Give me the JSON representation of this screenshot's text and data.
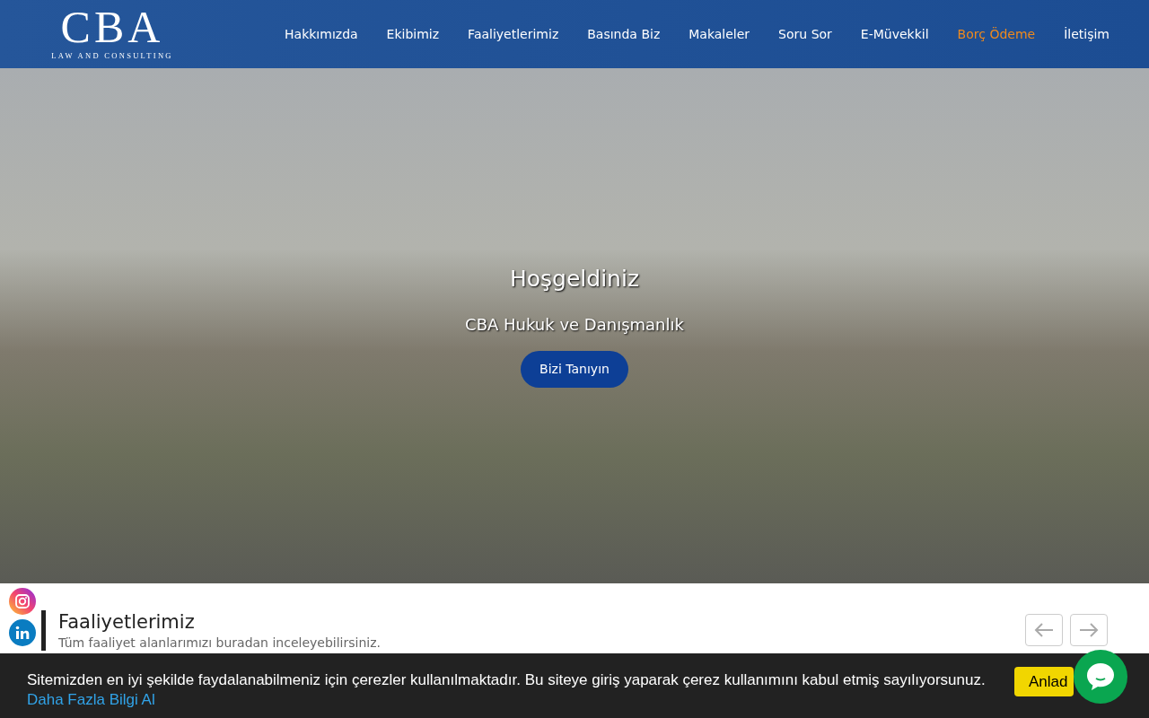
{
  "logo": {
    "letters": "CBA",
    "tagline": "LAW AND CONSULTING"
  },
  "nav": [
    {
      "label": "Hakkımızda",
      "highlighted": false
    },
    {
      "label": "Ekibimiz",
      "highlighted": false
    },
    {
      "label": "Faaliyetlerimiz",
      "highlighted": false
    },
    {
      "label": "Basında Biz",
      "highlighted": false
    },
    {
      "label": "Makaleler",
      "highlighted": false
    },
    {
      "label": "Soru Sor",
      "highlighted": false
    },
    {
      "label": "E-Müvekkil",
      "highlighted": false
    },
    {
      "label": "Borç Ödeme",
      "highlighted": true
    },
    {
      "label": "İletişim",
      "highlighted": false
    }
  ],
  "hero": {
    "title": "Hoşgeldiniz",
    "subtitle": "CBA Hukuk ve Danışmanlık",
    "button": "Bizi Tanıyın"
  },
  "social": [
    {
      "kind": "instagram"
    },
    {
      "kind": "linkedin"
    }
  ],
  "section": {
    "title": "Faaliyetlerimiz",
    "subtitle": "Tüm faaliyet alanlarımızı buradan inceleyebilirsiniz."
  },
  "cookie": {
    "text": "Sitemizden en iyi şekilde faydalanabilmeniz için çerezler kullanılmaktadır. Bu siteye giriş yaparak çerez kullanımını kabul etmiş sayılıyorsunuz.",
    "link": "Daha Fazla Bilgi Al",
    "button": "Anlad"
  }
}
